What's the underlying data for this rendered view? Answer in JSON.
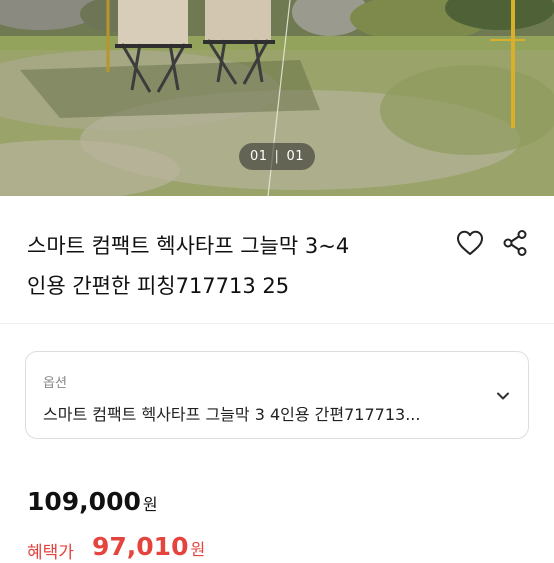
{
  "gallery": {
    "current": "01",
    "total": "01",
    "image_alt": "campsite photo with folding chairs on grass"
  },
  "product": {
    "title_line1": "스마트 컴팩트 헥사타프 그늘막 3~4",
    "title_line2": "인용 간편한 피칭717713 25",
    "like_icon": "heart-icon",
    "share_icon": "share-icon"
  },
  "option": {
    "label": "옵션",
    "value": "스마트 컴팩트 헥사타프 그늘막 3 4인용 간편717713...",
    "chevron_icon": "chevron-down-icon"
  },
  "price": {
    "original": "109,000",
    "currency": "원",
    "benefit_label": "혜택가",
    "benefit_price": "97,010",
    "accent_color": "#e5433e"
  }
}
